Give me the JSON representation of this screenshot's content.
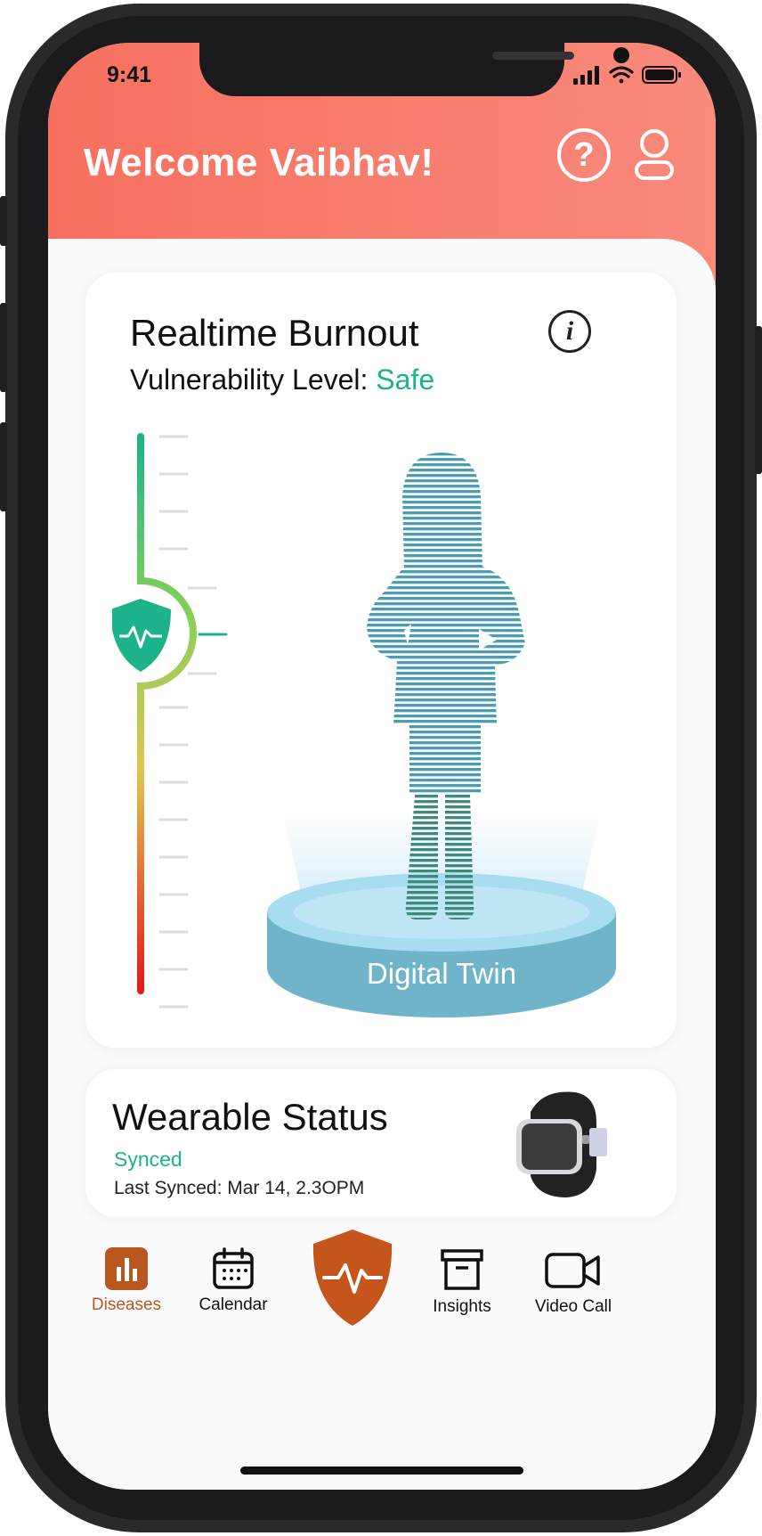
{
  "status_bar": {
    "time": "9:41"
  },
  "header": {
    "welcome_text": "Welcome Vaibhav!",
    "help_icon": "help-circle-icon",
    "profile_icon": "user-icon"
  },
  "burnout_card": {
    "title": "Realtime Burnout",
    "vulnerability_label": "Vulnerability Level:",
    "vulnerability_value": "Safe",
    "info_icon": "info-icon",
    "level_icon": "shield-heartbeat-icon",
    "twin_label": "Digital Twin",
    "colors": {
      "safe": "#1db38a",
      "gauge_top": "#1db38a",
      "gauge_mid": "#e2c552",
      "gauge_bottom": "#e11a1a"
    }
  },
  "wearable_card": {
    "title": "Wearable Status",
    "status": "Synced",
    "last_synced": "Last Synced: Mar 14, 2.3OPM",
    "device_icon": "smartwatch-icon"
  },
  "bottom_nav": {
    "items": [
      {
        "label": "Diseases",
        "icon": "bar-chart-icon",
        "active": true
      },
      {
        "label": "Calendar",
        "icon": "calendar-icon",
        "active": false
      },
      {
        "label": "",
        "icon": "shield-heartbeat-icon",
        "active": false
      },
      {
        "label": "Insights",
        "icon": "archive-box-icon",
        "active": false
      },
      {
        "label": "Video Call",
        "icon": "video-camera-icon",
        "active": false
      }
    ],
    "accent_color": "#b8581f"
  }
}
